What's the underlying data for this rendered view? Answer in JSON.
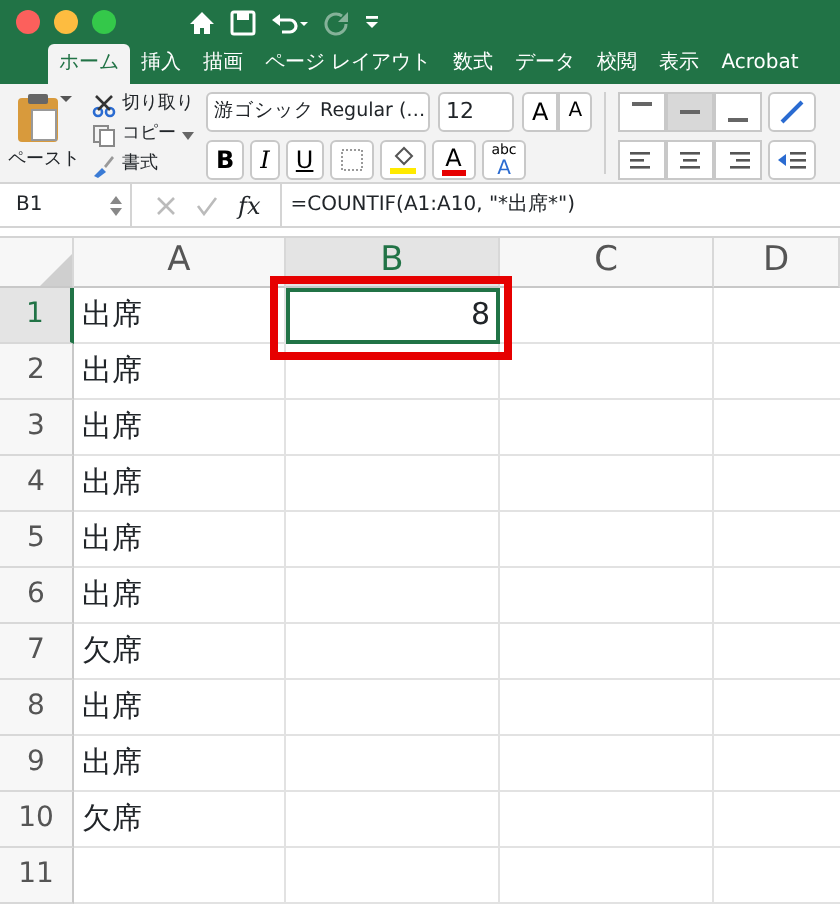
{
  "title_bar": {
    "window_buttons": [
      {
        "color": "#fc605c"
      },
      {
        "color": "#fdbc40"
      },
      {
        "color": "#34c84a"
      }
    ],
    "redo_disabled": true
  },
  "tabs": [
    {
      "label": "ホーム",
      "selected": true
    },
    {
      "label": "挿入",
      "selected": false
    },
    {
      "label": "描画",
      "selected": false
    },
    {
      "label": "ページ レイアウト",
      "selected": false
    },
    {
      "label": "数式",
      "selected": false
    },
    {
      "label": "データ",
      "selected": false
    },
    {
      "label": "校閲",
      "selected": false
    },
    {
      "label": "表示",
      "selected": false
    },
    {
      "label": "Acrobat",
      "selected": false
    }
  ],
  "clipboard": {
    "paste": "ペースト",
    "cut": "切り取り",
    "copy": "コピー",
    "format": "書式"
  },
  "font": {
    "name": "游ゴシック Regular (…",
    "size": "12",
    "grow": "A",
    "shrink": "A",
    "bold": "B",
    "italic": "I",
    "underline": "U",
    "font_color": "A",
    "phonetic_top": "abc",
    "phonetic_bottom": "A"
  },
  "vertical_align": [
    {
      "kind": "top",
      "selected": false
    },
    {
      "kind": "middle",
      "selected": true
    },
    {
      "kind": "bottom",
      "selected": false
    }
  ],
  "formula_bar": {
    "name_box": "B1",
    "fx": "fx",
    "formula": "=COUNTIF(A1:A10, \"*出席*\")"
  },
  "columns": [
    {
      "label": "A",
      "selected": false
    },
    {
      "label": "B",
      "selected": true
    },
    {
      "label": "C",
      "selected": false
    },
    {
      "label": "D",
      "selected": false
    }
  ],
  "rows": [
    {
      "label": "1",
      "selected": true,
      "cells": [
        {
          "text": "出席",
          "selected": false
        },
        {
          "text": "8",
          "selected": true
        }
      ]
    },
    {
      "label": "2",
      "selected": false,
      "cells": [
        {
          "text": "出席",
          "selected": false
        }
      ]
    },
    {
      "label": "3",
      "selected": false,
      "cells": [
        {
          "text": "出席",
          "selected": false
        }
      ]
    },
    {
      "label": "4",
      "selected": false,
      "cells": [
        {
          "text": "出席",
          "selected": false
        }
      ]
    },
    {
      "label": "5",
      "selected": false,
      "cells": [
        {
          "text": "出席",
          "selected": false
        }
      ]
    },
    {
      "label": "6",
      "selected": false,
      "cells": [
        {
          "text": "出席",
          "selected": false
        }
      ]
    },
    {
      "label": "7",
      "selected": false,
      "cells": [
        {
          "text": "欠席",
          "selected": false
        }
      ]
    },
    {
      "label": "8",
      "selected": false,
      "cells": [
        {
          "text": "出席",
          "selected": false
        }
      ]
    },
    {
      "label": "9",
      "selected": false,
      "cells": [
        {
          "text": "出席",
          "selected": false
        }
      ]
    },
    {
      "label": "10",
      "selected": false,
      "cells": [
        {
          "text": "欠席",
          "selected": false
        }
      ]
    },
    {
      "label": "11",
      "selected": false,
      "cells": []
    }
  ],
  "highlight_frame": {
    "shown": true
  }
}
